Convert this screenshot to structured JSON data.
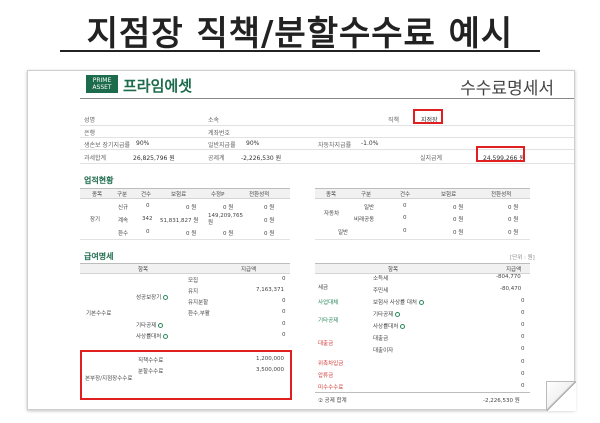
{
  "page_title": "지점장 직책/분할수수료 예시",
  "logo": {
    "mark_top": "PRIME",
    "mark_bottom": "ASSET",
    "name": "프라임에셋"
  },
  "doc_title": "수수료명세서",
  "info": {
    "name_label": "성명",
    "affil_label": "소속",
    "position_label": "직책",
    "position_value": "지점장",
    "bank_label": "은행",
    "account_label": "계좌번호",
    "life_label": "생손보 장기지급률",
    "life_value": "90%",
    "general_label": "일반지급률",
    "general_value": "90%",
    "auto_label": "자동차지급률",
    "auto_value": "-1.0%",
    "total_label": "과세합계",
    "total_value": "26,825,796 원",
    "deduct_label": "공제계",
    "deduct_value": "-2,226,530 원",
    "net_label": "실지급계",
    "net_value": "24,599,266 원"
  },
  "performance": {
    "section": "업적현황",
    "left_headers": [
      "종목",
      "구분",
      "건수",
      "보험료",
      "수정P",
      "전환성적"
    ],
    "left_group": "장기",
    "left_rows": [
      [
        "신규",
        "0",
        "0 원",
        "0 원",
        "0 원"
      ],
      [
        "계속",
        "342",
        "51,831,827 원",
        "149,209,765 원",
        "0 원"
      ],
      [
        "환수",
        "0",
        "0 원",
        "0 원",
        "0 원"
      ]
    ],
    "right_headers": [
      "종목",
      "구분",
      "건수",
      "보험료",
      "전환성적"
    ],
    "right_group": "자동차",
    "right_rows": [
      [
        "일반",
        "0",
        "0 원",
        "0 원"
      ],
      [
        "비래공동",
        "0",
        "0 원",
        "0 원"
      ]
    ],
    "right_extra": [
      "일반",
      "0",
      "0 원",
      "0 원"
    ]
  },
  "pay": {
    "section": "급여명세",
    "unit": "[단위 : 원]",
    "left_headers": [
      "항목",
      "지급액"
    ],
    "basic_group": "기본수수료",
    "perf_group": "성공보장기",
    "perf_items": [
      [
        "모집",
        "0"
      ],
      [
        "유지",
        "7,163,371"
      ],
      [
        "유지분할",
        "0"
      ],
      [
        "환수,부활",
        "0"
      ]
    ],
    "other_items": [
      [
        "기타공제",
        "0"
      ],
      [
        "사상률대처",
        "0"
      ]
    ],
    "special_group": "본부장/지점장수수료",
    "special_items": [
      [
        "직책수수료",
        "1,200,000"
      ],
      [
        "분할수수료",
        "3,500,000"
      ]
    ],
    "right_headers": [
      "항목",
      "지급액"
    ],
    "tax_group": "세금",
    "tax_items": [
      [
        "소득세",
        "-804,770"
      ],
      [
        "주민세",
        "-80,470"
      ]
    ],
    "social_group": "사업대체",
    "social_items": [
      [
        "보험사 사상률 대처",
        "0"
      ]
    ],
    "other_group": "기타공제",
    "more_group": "대출금",
    "more_items": [
      [
        "대출금",
        "0"
      ],
      [
        "대출이자",
        "0"
      ]
    ],
    "red_rows": [
      [
        "위촉차입금",
        "0"
      ],
      [
        "압류금",
        "0"
      ],
      [
        "미수수수료",
        "0"
      ]
    ],
    "deduct_total_label": "② 공제 합계",
    "deduct_total_value": "-2,226,530 원"
  }
}
